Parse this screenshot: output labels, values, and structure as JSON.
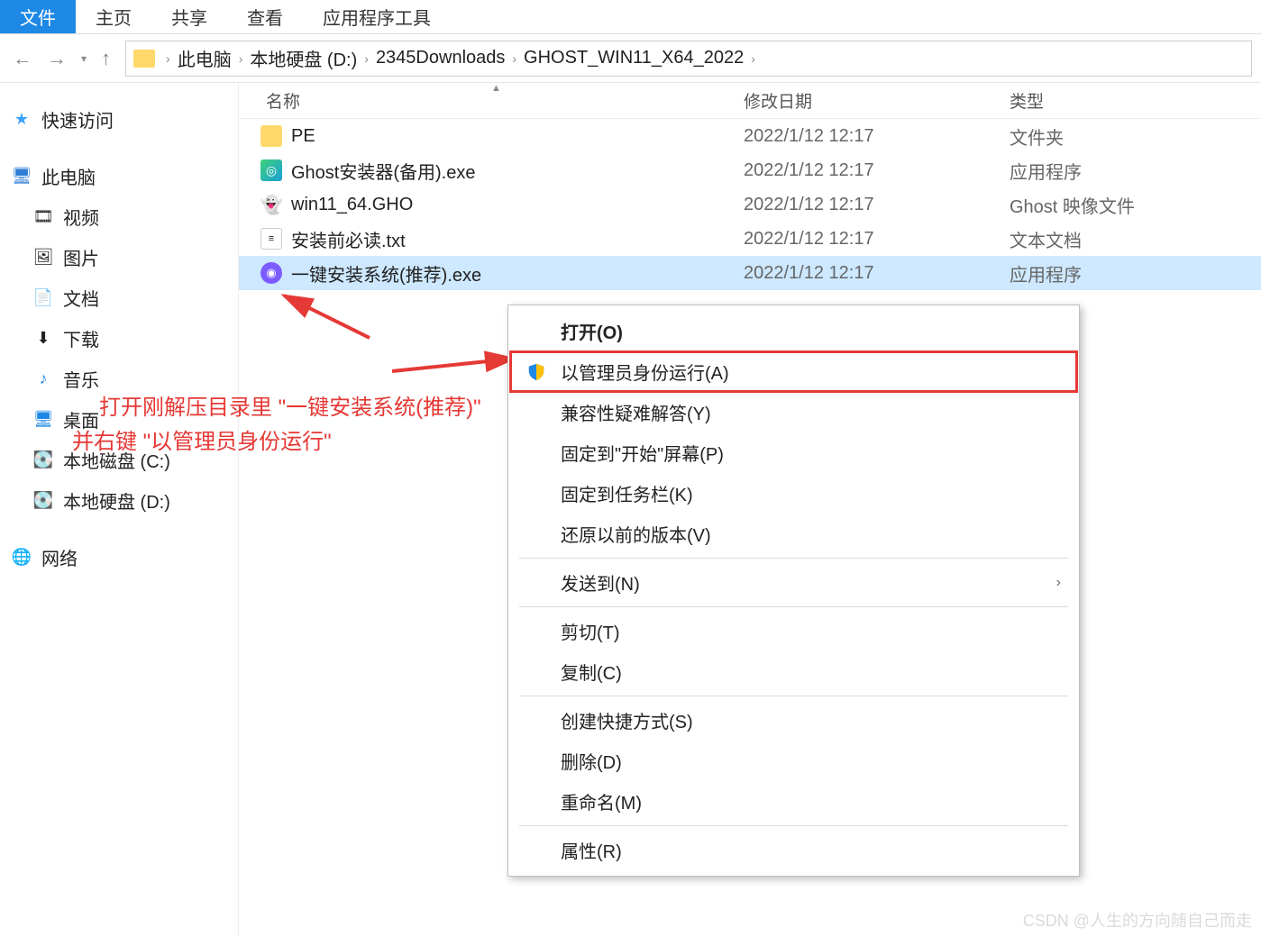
{
  "tabs": {
    "file": "文件",
    "home": "主页",
    "share": "共享",
    "view": "查看",
    "apptools": "应用程序工具"
  },
  "breadcrumb": [
    "此电脑",
    "本地硬盘 (D:)",
    "2345Downloads",
    "GHOST_WIN11_X64_2022"
  ],
  "columns": {
    "name": "名称",
    "date": "修改日期",
    "type": "类型"
  },
  "sidebar": {
    "quick": "快速访问",
    "thispc": "此电脑",
    "videos": "视频",
    "pictures": "图片",
    "documents": "文档",
    "downloads": "下载",
    "music": "音乐",
    "desktop": "桌面",
    "cdrive": "本地磁盘 (C:)",
    "ddrive": "本地硬盘 (D:)",
    "network": "网络"
  },
  "files": [
    {
      "name": "PE",
      "date": "2022/1/12 12:17",
      "type": "文件夹"
    },
    {
      "name": "Ghost安装器(备用).exe",
      "date": "2022/1/12 12:17",
      "type": "应用程序"
    },
    {
      "name": "win11_64.GHO",
      "date": "2022/1/12 12:17",
      "type": "Ghost 映像文件"
    },
    {
      "name": "安装前必读.txt",
      "date": "2022/1/12 12:17",
      "type": "文本文档"
    },
    {
      "name": "一键安装系统(推荐).exe",
      "date": "2022/1/12 12:17",
      "type": "应用程序"
    }
  ],
  "ctx": {
    "open": "打开(O)",
    "runadmin": "以管理员身份运行(A)",
    "compat": "兼容性疑难解答(Y)",
    "pinstart": "固定到\"开始\"屏幕(P)",
    "pintask": "固定到任务栏(K)",
    "restore": "还原以前的版本(V)",
    "sendto": "发送到(N)",
    "cut": "剪切(T)",
    "copy": "复制(C)",
    "shortcut": "创建快捷方式(S)",
    "delete": "删除(D)",
    "rename": "重命名(M)",
    "props": "属性(R)"
  },
  "anno": {
    "l1": "打开刚解压目录里 \"一键安装系统(推荐)\"",
    "l2": "并右键 \"以管理员身份运行\""
  },
  "watermark": "CSDN @人生的方向随自己而走"
}
